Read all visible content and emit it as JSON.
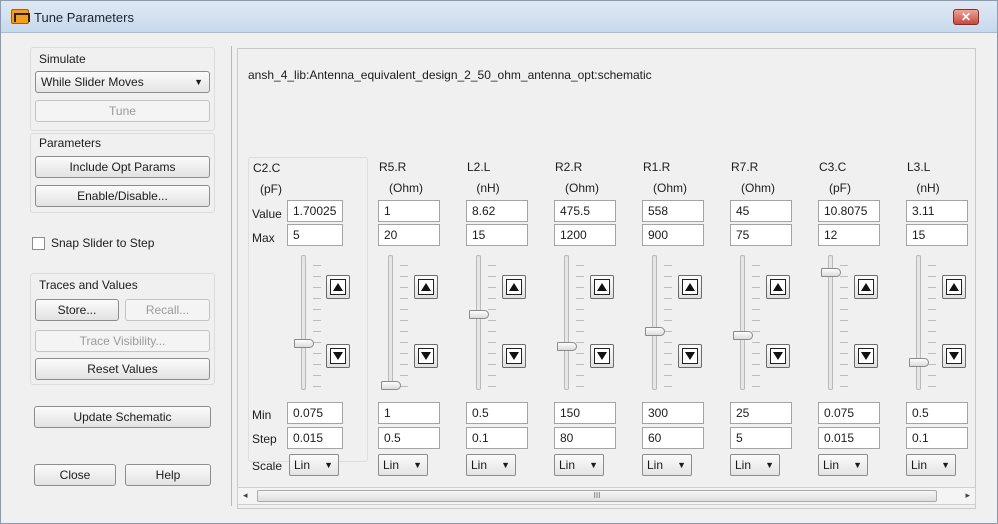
{
  "window": {
    "title": "Tune Parameters",
    "close_symbol": "✕"
  },
  "simulate": {
    "label": "Simulate",
    "mode_selected": "While Slider Moves",
    "tune_label": "Tune"
  },
  "parameters": {
    "label": "Parameters",
    "include_opt_label": "Include Opt Params",
    "enable_disable_label": "Enable/Disable..."
  },
  "snap": {
    "label": "Snap Slider to Step",
    "checked": false
  },
  "traces": {
    "label": "Traces and Values",
    "store_label": "Store...",
    "recall_label": "Recall...",
    "visibility_label": "Trace Visibility...",
    "reset_label": "Reset Values"
  },
  "update_label": "Update Schematic",
  "close_label": "Close",
  "help_label": "Help",
  "schematic_path": "ansh_4_lib:Antenna_equivalent_design_2_50_ohm_antenna_opt:schematic",
  "row_labels": {
    "value": "Value",
    "max": "Max",
    "min": "Min",
    "step": "Step",
    "scale": "Scale"
  },
  "params": [
    {
      "name": "C2.C",
      "unit": "(pF)",
      "value": "1.70025",
      "max": "5",
      "min": "0.075",
      "step": "0.015",
      "scale": "Lin",
      "slider_level": 0.33
    },
    {
      "name": "R5.R",
      "unit": "(Ohm)",
      "value": "1",
      "max": "20",
      "min": "1",
      "step": "0.5",
      "scale": "Lin",
      "slider_level": 0.0
    },
    {
      "name": "L2.L",
      "unit": "(nH)",
      "value": "8.62",
      "max": "15",
      "min": "0.5",
      "step": "0.1",
      "scale": "Lin",
      "slider_level": 0.56
    },
    {
      "name": "R2.R",
      "unit": "(Ohm)",
      "value": "475.5",
      "max": "1200",
      "min": "150",
      "step": "80",
      "scale": "Lin",
      "slider_level": 0.31
    },
    {
      "name": "R1.R",
      "unit": "(Ohm)",
      "value": "558",
      "max": "900",
      "min": "300",
      "step": "60",
      "scale": "Lin",
      "slider_level": 0.43
    },
    {
      "name": "R7.R",
      "unit": "(Ohm)",
      "value": "45",
      "max": "75",
      "min": "25",
      "step": "5",
      "scale": "Lin",
      "slider_level": 0.4
    },
    {
      "name": "C3.C",
      "unit": "(pF)",
      "value": "10.8075",
      "max": "12",
      "min": "0.075",
      "step": "0.015",
      "scale": "Lin",
      "slider_level": 0.9
    },
    {
      "name": "L3.L",
      "unit": "(nH)",
      "value": "3.11",
      "max": "15",
      "min": "0.5",
      "step": "0.1",
      "scale": "Lin",
      "slider_level": 0.18
    }
  ],
  "scrollbar": {
    "grip": "III",
    "left_arrow": "◂",
    "right_arrow": "▸"
  }
}
